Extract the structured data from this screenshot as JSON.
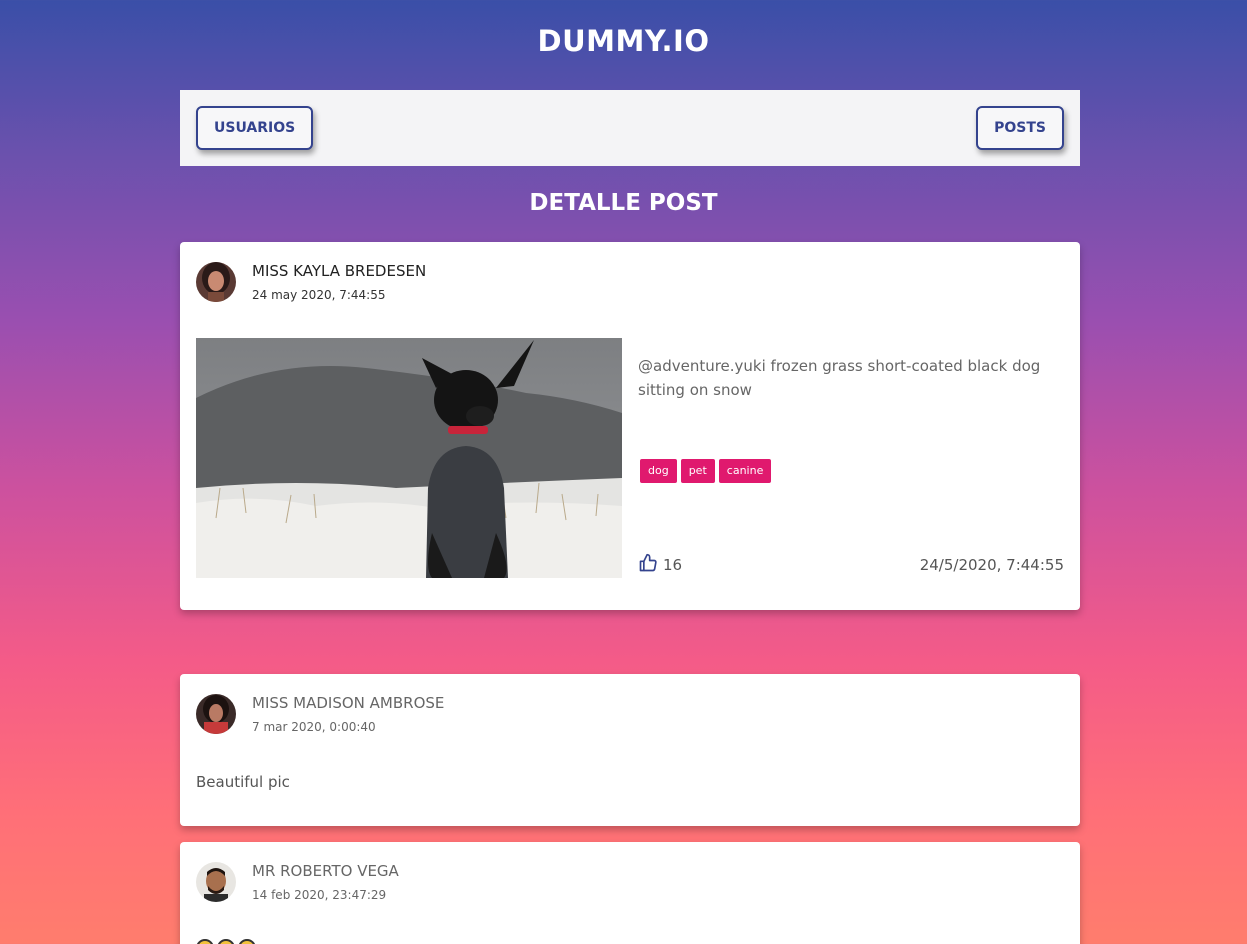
{
  "header": {
    "title": "DUMMY.IO"
  },
  "nav": {
    "users_label": "USUARIOS",
    "posts_label": "POSTS"
  },
  "page": {
    "title": "DETALLE POST"
  },
  "post": {
    "author": "MISS KAYLA BREDESEN",
    "date": "24 may 2020, 7:44:55",
    "text": "@adventure.yuki frozen grass short-coated black dog sitting on snow",
    "tags": [
      "dog",
      "pet",
      "canine"
    ],
    "likes": "16",
    "publish_date": "24/5/2020, 7:44:55",
    "image_icon": "photo-black-dog-on-snow",
    "like_icon": "thumbs-up-icon"
  },
  "comments": [
    {
      "author": "MISS MADISON AMBROSE",
      "date": "7 mar 2020, 0:00:40",
      "text": "Beautiful pic"
    },
    {
      "author": "MR ROBERTO VEGA",
      "date": "14 feb 2020, 23:47:29",
      "text": ""
    }
  ],
  "colors": {
    "accent": "#34438e",
    "tag": "#e0196e",
    "gradient_top": "#3a4fa8",
    "gradient_bottom": "#ff7d6d"
  }
}
